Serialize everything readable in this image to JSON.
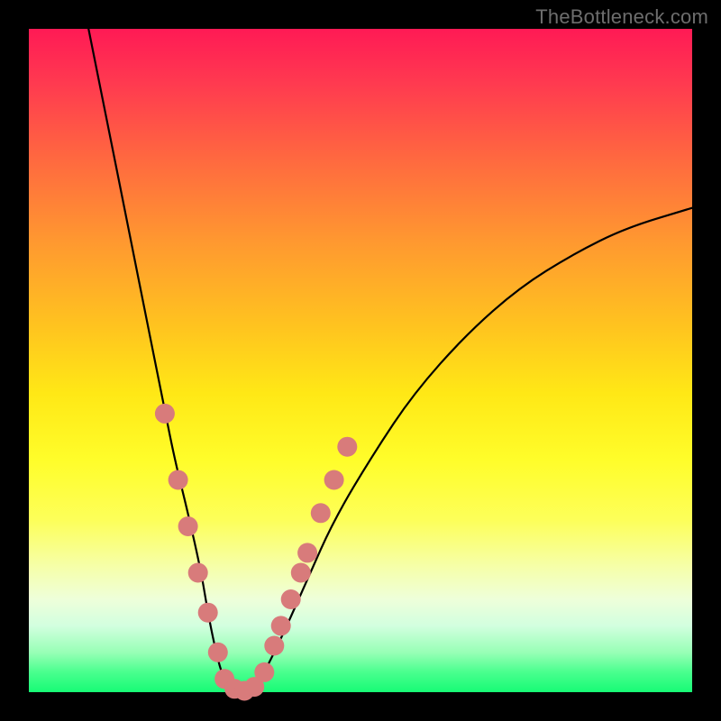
{
  "watermark": "TheBottleneck.com",
  "chart_data": {
    "type": "line",
    "title": "",
    "xlabel": "",
    "ylabel": "",
    "xlim": [
      0,
      100
    ],
    "ylim": [
      0,
      100
    ],
    "series": [
      {
        "name": "curve",
        "x": [
          9,
          12,
          15,
          18,
          20,
          22,
          24,
          26,
          27,
          28,
          29,
          30,
          31,
          32,
          33,
          35,
          38,
          42,
          46,
          52,
          58,
          66,
          74,
          82,
          90,
          100
        ],
        "y": [
          100,
          85,
          70,
          55,
          45,
          35,
          27,
          18,
          12,
          7,
          3,
          1,
          0,
          0,
          0,
          2,
          8,
          17,
          26,
          36,
          45,
          54,
          61,
          66,
          70,
          73
        ]
      }
    ],
    "markers": {
      "name": "pink-dots",
      "color": "#d87b7b",
      "points": [
        {
          "x": 20.5,
          "y": 42
        },
        {
          "x": 22.5,
          "y": 32
        },
        {
          "x": 24.0,
          "y": 25
        },
        {
          "x": 25.5,
          "y": 18
        },
        {
          "x": 27.0,
          "y": 12
        },
        {
          "x": 28.5,
          "y": 6
        },
        {
          "x": 29.5,
          "y": 2
        },
        {
          "x": 31.0,
          "y": 0.5
        },
        {
          "x": 32.5,
          "y": 0.2
        },
        {
          "x": 34.0,
          "y": 0.8
        },
        {
          "x": 35.5,
          "y": 3
        },
        {
          "x": 37.0,
          "y": 7
        },
        {
          "x": 38.0,
          "y": 10
        },
        {
          "x": 39.5,
          "y": 14
        },
        {
          "x": 41.0,
          "y": 18
        },
        {
          "x": 42.0,
          "y": 21
        },
        {
          "x": 44.0,
          "y": 27
        },
        {
          "x": 46.0,
          "y": 32
        },
        {
          "x": 48.0,
          "y": 37
        }
      ]
    }
  }
}
